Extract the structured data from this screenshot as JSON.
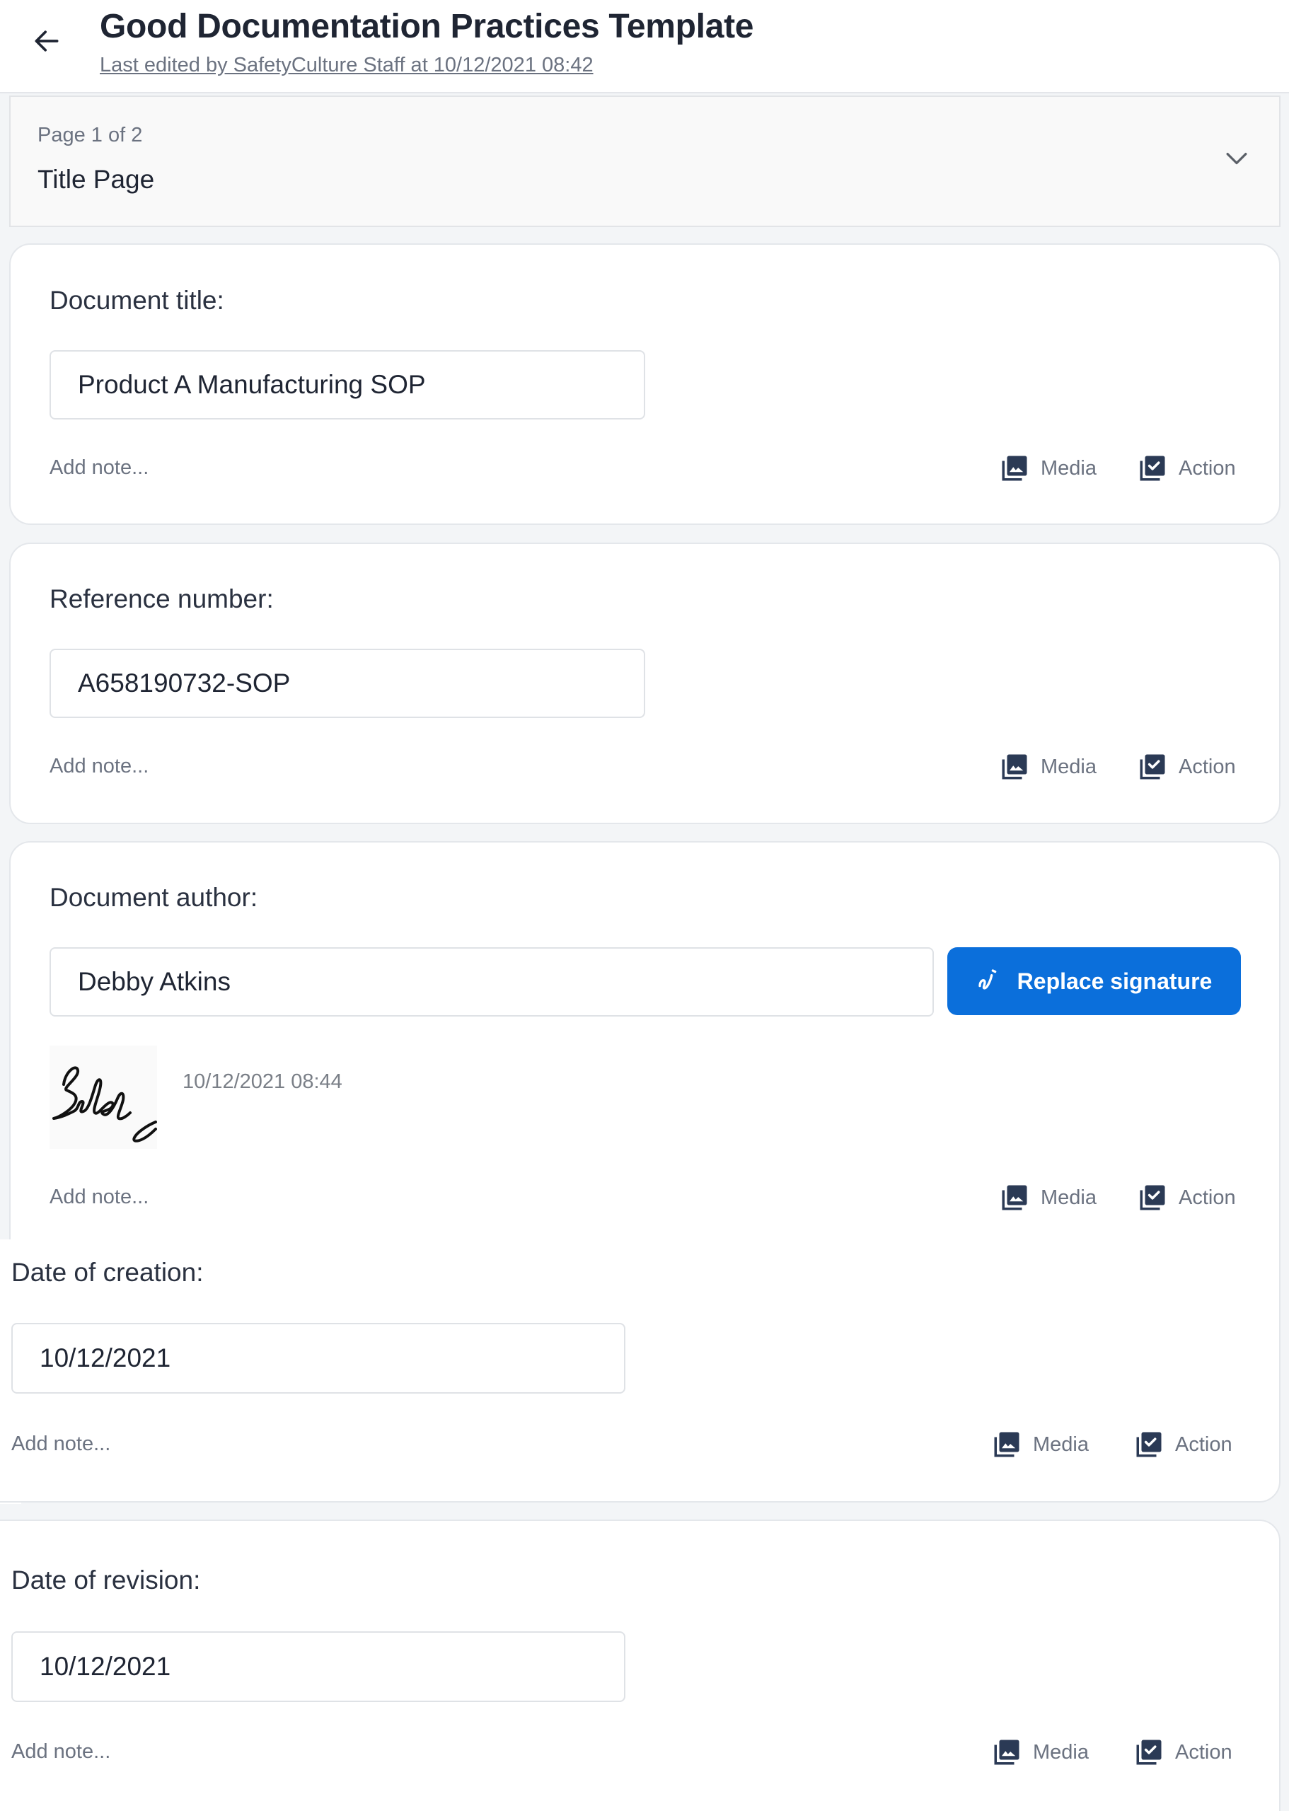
{
  "header": {
    "title": "Good Documentation Practices Template",
    "subtitle": "Last edited by SafetyCulture Staff at 10/12/2021 08:42",
    "back_icon": "arrow-left-icon"
  },
  "page_selector": {
    "page_count": "Page 1 of 2",
    "page_name": "Title Page",
    "icon": "chevron-down-icon"
  },
  "colors": {
    "accent": "#0b6fdb",
    "icon_dark": "#2b3a55",
    "page_bg": "#f3f5f7"
  },
  "common": {
    "add_note_placeholder": "Add note...",
    "media_label": "Media",
    "action_label": "Action"
  },
  "questions": [
    {
      "label": "Document title:",
      "value": "Product A Manufacturing SOP"
    },
    {
      "label": "Reference number:",
      "value": "A658190732-SOP"
    },
    {
      "label": "Document author:",
      "value": "Debby Atkins",
      "button_label": "Replace signature",
      "signature_timestamp": "10/12/2021 08:44"
    },
    {
      "label": "Date of creation:",
      "value": "10/12/2021"
    },
    {
      "label": "Date of revision:",
      "value": "10/12/2021"
    }
  ]
}
